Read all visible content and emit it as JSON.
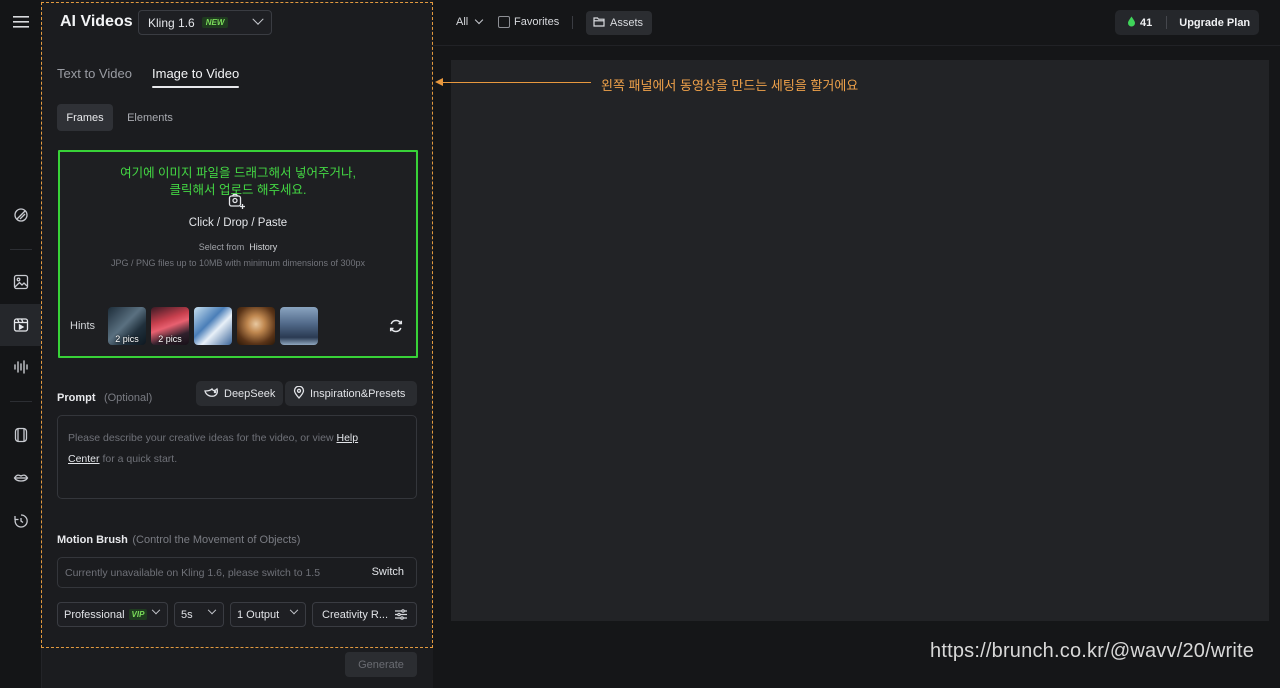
{
  "app": {
    "title": "AI Videos",
    "model": "Kling 1.6",
    "model_badge": "NEW"
  },
  "tabs": [
    {
      "label": "Text to Video",
      "active": false
    },
    {
      "label": "Image to Video",
      "active": true
    }
  ],
  "segments": [
    {
      "label": "Frames",
      "active": true
    },
    {
      "label": "Elements",
      "active": false
    }
  ],
  "upload": {
    "annotation_line1": "여기에 이미지 파일을 드래그해서 넣어주거나,",
    "annotation_line2": "클릭해서 업로드 해주세요.",
    "main_text": "Click / Drop / Paste",
    "select_from": "Select from",
    "history": "History",
    "note": "JPG / PNG files up to 10MB with minimum dimensions of 300px",
    "hints_label": "Hints",
    "hint_captions": [
      "2 pics",
      "2 pics",
      "",
      "",
      ""
    ]
  },
  "prompt": {
    "label": "Prompt",
    "optional": "(Optional)",
    "deepseek": "DeepSeek",
    "inspiration": "Inspiration&Presets",
    "placeholder_a": "Please describe your creative ideas for the video, or view",
    "help": "Help",
    "center": "Center",
    "placeholder_b": "for a quick start."
  },
  "motion": {
    "label": "Motion Brush",
    "sub": "(Control the Movement of Objects)",
    "placeholder": "Currently unavailable on Kling 1.6, please switch to 1.5",
    "switch": "Switch"
  },
  "options": {
    "mode": "Professional",
    "mode_badge": "VIP",
    "duration": "5s",
    "outputs": "1 Output",
    "creativity": "Creativity R..."
  },
  "generate": "Generate",
  "topbar": {
    "filter": "All",
    "favorites": "Favorites",
    "assets": "Assets",
    "credits": "41",
    "upgrade": "Upgrade Plan"
  },
  "annotation": "왼쪽 패널에서 동영상을 만드는 세팅을 할거에요",
  "watermark": "https://brunch.co.kr/@wavv/20/write",
  "colors": {
    "highlight_green": "#38d238",
    "annotation_orange": "#e8983e",
    "badge_green": "#7bdc5a"
  }
}
